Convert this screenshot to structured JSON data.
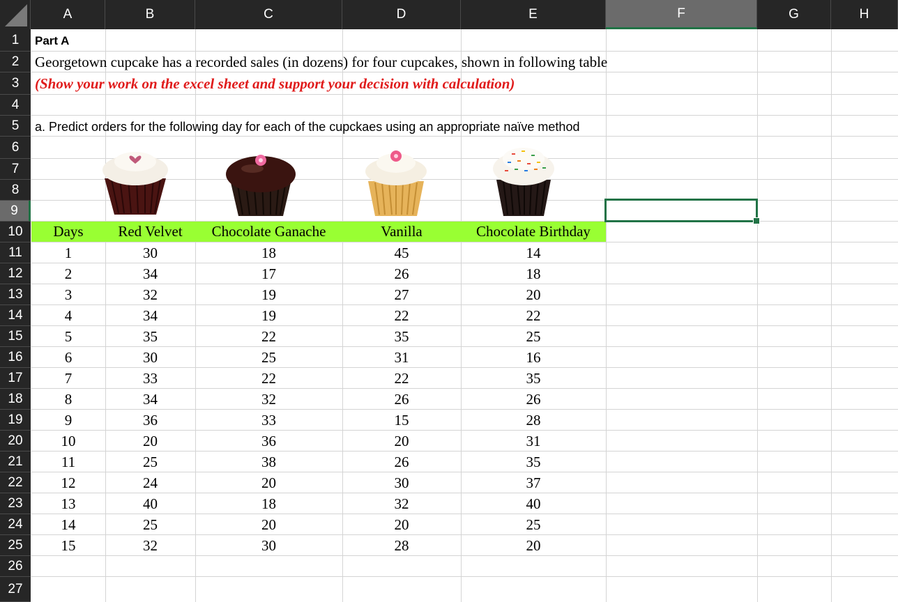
{
  "columns": [
    "A",
    "B",
    "C",
    "D",
    "E",
    "F",
    "G",
    "H"
  ],
  "rows": [
    "1",
    "2",
    "3",
    "4",
    "5",
    "6",
    "7",
    "8",
    "9",
    "10",
    "11",
    "12",
    "13",
    "14",
    "15",
    "16",
    "17",
    "18",
    "19",
    "20",
    "21",
    "22",
    "23",
    "24",
    "25",
    "26",
    "27"
  ],
  "selected_cell": "F9",
  "text": {
    "a1": "Part A",
    "a2": "Georgetown cupcake has a recorded sales (in dozens) for four cupcakes, shown in following table",
    "a3": "(Show your work on the excel sheet and support your decision with calculation)",
    "a5": "a. Predict orders for the following day for each of the cupckaes using an appropriate naïve method"
  },
  "table": {
    "headers": [
      "Days",
      "Red Velvet",
      "Chocolate Ganache",
      "Vanilla",
      "Chocolate Birthday"
    ],
    "rows": [
      [
        "1",
        "30",
        "18",
        "45",
        "14"
      ],
      [
        "2",
        "34",
        "17",
        "26",
        "18"
      ],
      [
        "3",
        "32",
        "19",
        "27",
        "20"
      ],
      [
        "4",
        "34",
        "19",
        "22",
        "22"
      ],
      [
        "5",
        "35",
        "22",
        "35",
        "25"
      ],
      [
        "6",
        "30",
        "25",
        "31",
        "16"
      ],
      [
        "7",
        "33",
        "22",
        "22",
        "35"
      ],
      [
        "8",
        "34",
        "32",
        "26",
        "26"
      ],
      [
        "9",
        "36",
        "33",
        "15",
        "28"
      ],
      [
        "10",
        "20",
        "36",
        "20",
        "31"
      ],
      [
        "11",
        "25",
        "38",
        "26",
        "35"
      ],
      [
        "12",
        "24",
        "20",
        "30",
        "37"
      ],
      [
        "13",
        "40",
        "18",
        "32",
        "40"
      ],
      [
        "14",
        "25",
        "20",
        "20",
        "25"
      ],
      [
        "15",
        "32",
        "30",
        "28",
        "20"
      ]
    ]
  },
  "images": [
    "red-velvet-cupcake",
    "chocolate-ganache-cupcake",
    "vanilla-cupcake",
    "chocolate-birthday-cupcake"
  ],
  "colors": {
    "header_bg": "#99ff33",
    "accent": "#217346",
    "red_text": "#e01b1b"
  }
}
